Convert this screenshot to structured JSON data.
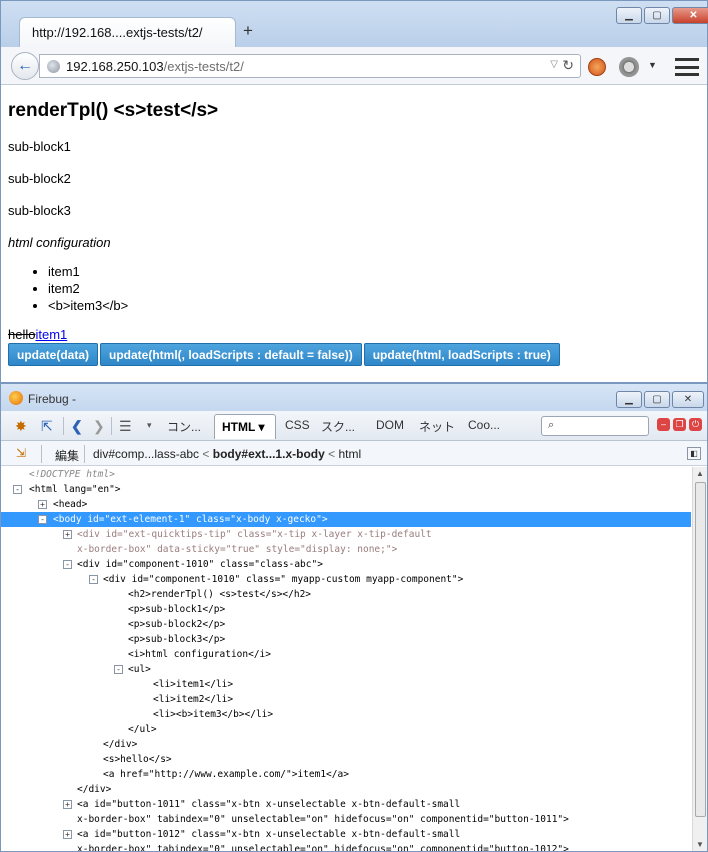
{
  "browser": {
    "tab_title": "http://192.168....extjs-tests/t2/",
    "new_tab_label": "+",
    "url_host": "192.168.250.103",
    "url_path": "/extjs-tests/t2/",
    "window_buttons": {
      "minimize": "▁",
      "maximize": "▢",
      "close": "✕"
    },
    "back_label": "←",
    "reload_label": "↻",
    "drop_label": "▽"
  },
  "page": {
    "heading": "renderTpl() <s>test</s>",
    "blocks": [
      "sub-block1",
      "sub-block2",
      "sub-block3"
    ],
    "italic_text": "html configuration",
    "list_items": [
      "item1",
      "item2",
      "<b>item3</b>"
    ],
    "struck_text": "hello",
    "link_text": "item1",
    "buttons": [
      "update(data)",
      "update(html(, loadScripts : default = false))",
      "update(html, loadScripts : true)"
    ],
    "colors": {
      "button_blue": "#3a91d4",
      "selection_blue": "#3399ff"
    }
  },
  "firebug": {
    "title": "Firebug -",
    "tabs": [
      "コン...",
      "HTML ▾",
      "CSS",
      "スク...",
      "DOM",
      "ネット",
      "Coo..."
    ],
    "search_placeholder": "",
    "breadcrumb": {
      "edit_label": "編集",
      "part1": "div#comp...lass-abc",
      "part2": "body#ext...1.x-body",
      "part3": "html",
      "sep": "<"
    },
    "tree": [
      {
        "t": "<!DOCTYPE html>"
      },
      {
        "t": "<html lang=\"en\">"
      },
      {
        "t": "<head>"
      },
      {
        "t": "<body id=\"ext-element-1\" class=\"x-body x-gecko\">"
      },
      {
        "t": "<div id=\"ext-quicktips-tip\" class=\"x-tip x-layer x-tip-default"
      },
      {
        "t": "x-border-box\" data-sticky=\"true\" style=\"display: none;\">"
      },
      {
        "t": "<div id=\"component-1010\" class=\"class-abc\">"
      },
      {
        "t": "<div id=\"component-1010\" class=\" myapp-custom myapp-component\">"
      },
      {
        "t": "<h2>renderTpl() <s>test</s></h2>"
      },
      {
        "t": "<p>sub-block1</p>"
      },
      {
        "t": "<p>sub-block2</p>"
      },
      {
        "t": "<p>sub-block3</p>"
      },
      {
        "t": "<i>html configuration</i>"
      },
      {
        "t": "<ul>"
      },
      {
        "t": "<li>item1</li>"
      },
      {
        "t": "<li>item2</li>"
      },
      {
        "t": "<li><b>item3</b></li>"
      },
      {
        "t": "</ul>"
      },
      {
        "t": "</div>"
      },
      {
        "t": "<s>hello</s>"
      },
      {
        "t": "<a href=\"http://www.example.com/\">item1</a>"
      },
      {
        "t": "</div>"
      },
      {
        "t": "<a id=\"button-1011\" class=\"x-btn x-unselectable x-btn-default-small"
      },
      {
        "t": "x-border-box\" tabindex=\"0\" unselectable=\"on\" hidefocus=\"on\" componentid=\"button-1011\">"
      },
      {
        "t": "<a id=\"button-1012\" class=\"x-btn x-unselectable x-btn-default-small"
      },
      {
        "t": "x-border-box\" tabindex=\"0\" unselectable=\"on\" hidefocus=\"on\" componentid=\"button-1012\">"
      }
    ]
  }
}
